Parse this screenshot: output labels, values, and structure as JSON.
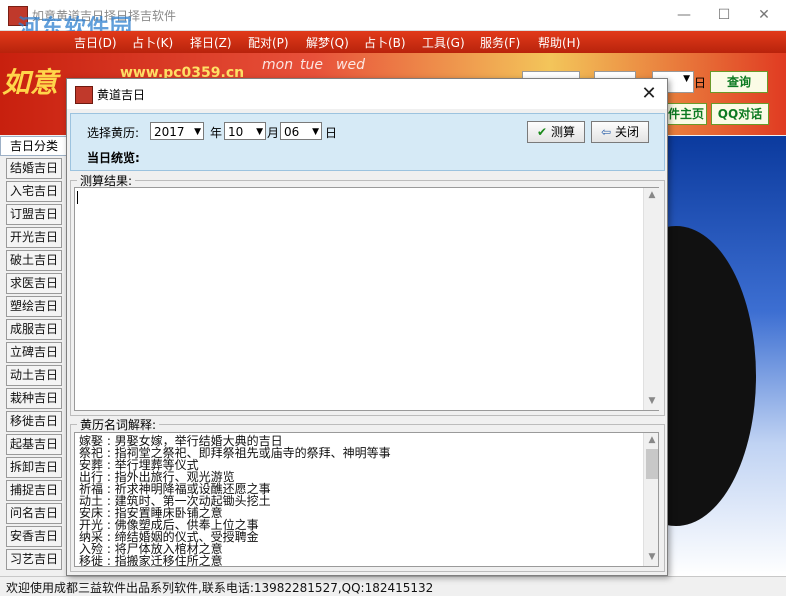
{
  "window": {
    "title": "如意黄道吉日择日择吉软件",
    "watermark": "河东软件园",
    "controls": {
      "minimize": "—",
      "maximize": "☐",
      "close": "✕"
    }
  },
  "menubar": {
    "items": [
      "吉日(D)",
      "占卜(K)",
      "择日(Z)",
      "配对(P)",
      "解梦(Q)",
      "占卜(B)",
      "工具(G)",
      "服务(F)",
      "帮助(H)"
    ]
  },
  "banner": {
    "calendar_text": "如意",
    "url": "www.pc0359.cn",
    "weekdays": [
      "mon",
      "tue",
      "wed"
    ],
    "date_suffix": "日",
    "query_button": "查询",
    "homepage_button": "件主页",
    "qq_button": "QQ对话"
  },
  "sidebar": {
    "header": "吉日分类",
    "items": [
      "结婚吉日",
      "入宅吉日",
      "订盟吉日",
      "开光吉日",
      "破土吉日",
      "求医吉日",
      "塑绘吉日",
      "成服吉日",
      "立碑吉日",
      "动土吉日",
      "栽种吉日",
      "移徙吉日",
      "起基吉日",
      "拆卸吉日",
      "捕捉吉日",
      "问名吉日",
      "安香吉日",
      "习艺吉日"
    ]
  },
  "dialog": {
    "title": "黄道吉日",
    "close": "✕",
    "select_label": "选择黄历:",
    "year": "2017",
    "year_unit": "年",
    "month": "10",
    "month_unit": "月",
    "day": "06",
    "day_unit": "日",
    "calc_button": "测算",
    "close_button": "关闭",
    "overview_label": "当日统览:",
    "result_group": "测算结果:",
    "result_text": "",
    "glossary_group": "黄历名词解释:",
    "glossary": [
      "嫁娶 : 男娶女嫁，举行结婚大典的吉日",
      "祭祀 : 指祠堂之祭祀、即拜祭祖先或庙寺的祭拜、神明等事",
      "安葬 : 举行埋葬等仪式",
      "出行 : 指外出旅行、观光游览",
      "祈福 : 祈求神明降福或设醮还愿之事",
      "动土 : 建筑时、第一次动起锄头挖土",
      "安床 : 指安置睡床卧铺之意",
      "开光 : 佛像塑成后、供奉上位之事",
      "纳采 : 缔结婚姻的仪式、受授聘金",
      "入殓 : 将尸体放入棺材之意",
      "移徙 : 指搬家迁移住所之意"
    ]
  },
  "statusbar": {
    "text": "欢迎使用成都三益软件出品系列软件,联系电话:13982281527,QQ:182415132"
  }
}
